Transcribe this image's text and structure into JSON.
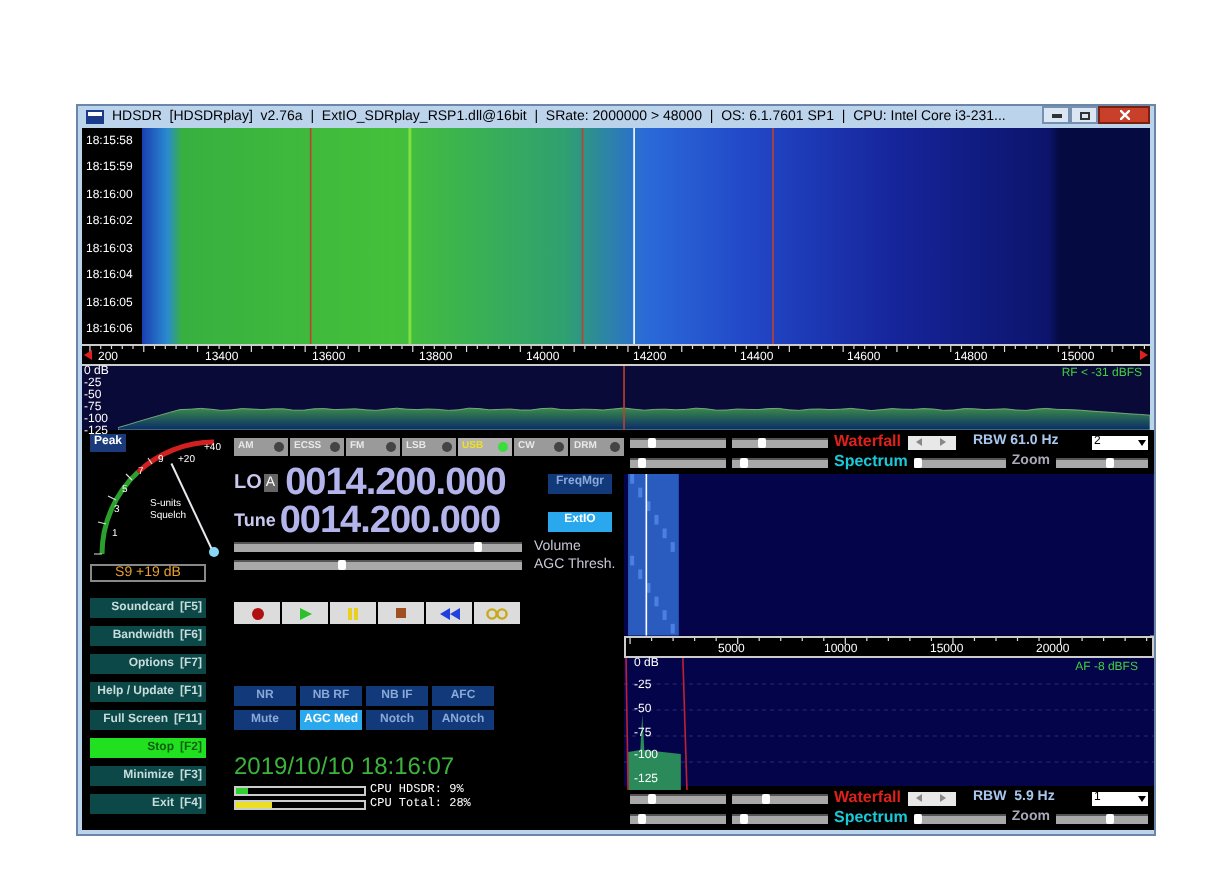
{
  "window": {
    "title": "HDSDR  [HDSDRplay]  v2.76a  |  ExtIO_SDRplay_RSP1.dll@16bit  |  SRate: 2000000 > 48000  |  OS: 6.1.7601 SP1  |  CPU: Intel Core i3-231..."
  },
  "waterfall": {
    "times": [
      "18:15:58",
      "18:15:59",
      "18:16:00",
      "18:16:02",
      "18:16:03",
      "18:16:04",
      "18:16:05",
      "18:16:06"
    ]
  },
  "rf_scale": {
    "ticks": [
      "200",
      "13400",
      "13600",
      "13800",
      "14000",
      "14200",
      "14400",
      "14600",
      "14800",
      "15000"
    ]
  },
  "rf_spectrum": {
    "db_labels": [
      "0 dB",
      "-25",
      "-50",
      "-75",
      "-100",
      "-125"
    ],
    "reading": "RF < -31 dBFS"
  },
  "smeter": {
    "peak": "Peak",
    "scale": [
      "1",
      "3",
      "5",
      "7",
      "9",
      "+20",
      "+40"
    ],
    "units": "S-units",
    "squelch": "Squelch",
    "reading": "S9 +19 dB"
  },
  "modes": [
    {
      "label": "AM",
      "selected": false
    },
    {
      "label": "ECSS",
      "selected": false
    },
    {
      "label": "FM",
      "selected": false
    },
    {
      "label": "LSB",
      "selected": false
    },
    {
      "label": "USB",
      "selected": true
    },
    {
      "label": "CW",
      "selected": false
    },
    {
      "label": "DRM",
      "selected": false
    }
  ],
  "lo": {
    "label": "LO",
    "bank": "A",
    "frequency": "0014.200.000"
  },
  "tune": {
    "label": "Tune",
    "frequency": "0014.200.000"
  },
  "side_buttons": [
    {
      "label": "FreqMgr",
      "selected": false
    },
    {
      "label": "ExtIO",
      "selected": true
    }
  ],
  "sliders": [
    {
      "label": "Volume",
      "level": 0.86
    },
    {
      "label": "AGC Thresh.",
      "level": 0.37
    }
  ],
  "menu_buttons": [
    {
      "label": "Soundcard",
      "key": "[F5]",
      "selected": false
    },
    {
      "label": "Bandwidth",
      "key": "[F6]",
      "selected": false
    },
    {
      "label": "Options",
      "key": "[F7]",
      "selected": false
    },
    {
      "label": "Help / Update",
      "key": "[F1]",
      "selected": false
    },
    {
      "label": "Full Screen",
      "key": "[F11]",
      "selected": false
    },
    {
      "label": "Stop",
      "key": "[F2]",
      "selected": true
    },
    {
      "label": "Minimize",
      "key": "[F3]",
      "selected": false
    },
    {
      "label": "Exit",
      "key": "[F4]",
      "selected": false
    }
  ],
  "dsp_buttons": [
    {
      "label": "NR",
      "selected": false
    },
    {
      "label": "NB RF",
      "selected": false
    },
    {
      "label": "NB IF",
      "selected": false
    },
    {
      "label": "AFC",
      "selected": false
    },
    {
      "label": "Mute",
      "selected": false
    },
    {
      "label": "AGC Med",
      "selected": true
    },
    {
      "label": "Notch",
      "selected": false
    },
    {
      "label": "ANotch",
      "selected": false
    }
  ],
  "clock": "2019/10/10 18:16:07",
  "cpu": [
    {
      "label": "CPU HDSDR:",
      "value": "9%",
      "level": 0.09
    },
    {
      "label": "CPU Total:",
      "value": "28%",
      "level": 0.28
    }
  ],
  "rf_controls": {
    "waterfall": "Waterfall",
    "spectrum": "Spectrum",
    "rbw": "RBW 61.0 Hz",
    "zoom": "Zoom",
    "dropdown": "2",
    "sliders": [
      {
        "level": 0.2
      },
      {
        "level": 0.3
      },
      {
        "level": 0.1
      },
      {
        "level": 0.1
      },
      {
        "level": 0.0
      },
      {
        "level": 0.6
      }
    ]
  },
  "af_scale": {
    "ticks": [
      "5000",
      "10000",
      "15000",
      "20000"
    ]
  },
  "af_spectrum": {
    "db_labels": [
      "0 dB",
      "-25",
      "-50",
      "-75",
      "-100",
      "-125"
    ],
    "reading": "AF -8 dBFS"
  },
  "af_controls": {
    "waterfall": "Waterfall",
    "spectrum": "Spectrum",
    "rbw": "RBW  5.9 Hz",
    "zoom": "Zoom",
    "dropdown": "1",
    "sliders": [
      {
        "level": 0.2
      },
      {
        "level": 0.35
      },
      {
        "level": 0.1
      },
      {
        "level": 0.1
      },
      {
        "level": 0.0
      },
      {
        "level": 0.6
      }
    ]
  }
}
